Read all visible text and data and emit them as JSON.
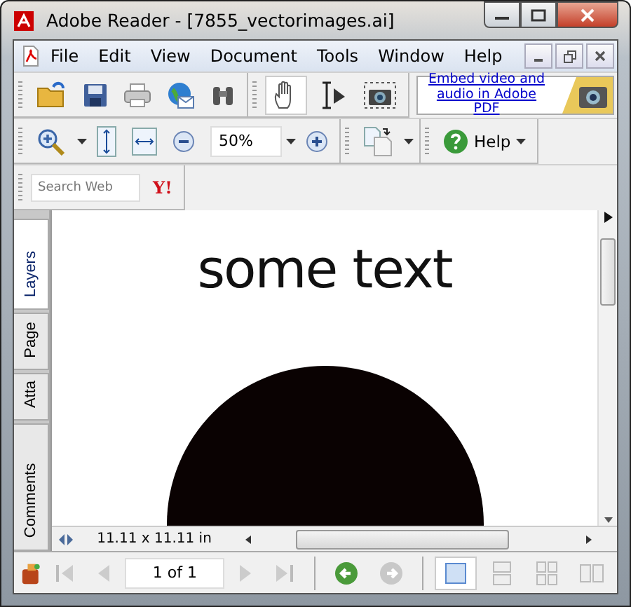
{
  "window": {
    "title": "Adobe Reader - [7855_vectorimages.ai]"
  },
  "menu": [
    "File",
    "Edit",
    "View",
    "Document",
    "Tools",
    "Window",
    "Help"
  ],
  "tools": [
    {
      "kind": "hand",
      "selected": true
    },
    {
      "kind": "select",
      "selected": false
    },
    {
      "kind": "snapshot",
      "selected": false
    }
  ],
  "banner": {
    "link": "Embed video and audio in Adobe PDF"
  },
  "zoom": {
    "value": "50%"
  },
  "help_button": "Help",
  "search": {
    "placeholder": "Search Web"
  },
  "search_logo": "Y!",
  "side_tabs": [
    {
      "label": "Layers",
      "selected": true
    },
    {
      "label": "Page",
      "selected": false
    },
    {
      "label": "Atta",
      "selected": false
    },
    {
      "label": "Comments",
      "selected": false
    }
  ],
  "document": {
    "text": "some text"
  },
  "page_size": "11.11 x 11.11 in",
  "page_field": {
    "value": "1 of 1"
  },
  "view_modes": [
    {
      "kind": "single",
      "selected": true
    },
    {
      "kind": "continuous",
      "selected": false
    },
    {
      "kind": "facing-continuous",
      "selected": false
    },
    {
      "kind": "facing",
      "selected": false
    }
  ]
}
